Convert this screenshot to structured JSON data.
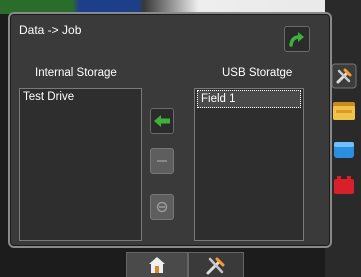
{
  "dialog": {
    "title": "Data -> Job"
  },
  "storage": {
    "internal_label": "Internal Storage",
    "usb_label": "USB Storatge",
    "internal_items": [
      "Test Drive"
    ],
    "usb_items": [
      "Field 1"
    ],
    "usb_selected_index": 0
  },
  "icons": {
    "ok": "green-curved-arrow-icon",
    "transfer_left": "green-left-arrow-icon",
    "edit": "edit-icon",
    "delete": "delete-icon",
    "tools": "wrench-hammer-icon",
    "folder": "folder-icon",
    "blue_item": "blue-box-icon",
    "red_item": "red-box-icon",
    "home": "home-icon"
  },
  "colors": {
    "accent_green": "#3cb13c",
    "dialog_bg": "#3a3a3a",
    "panel_bg": "#2e2e2e"
  }
}
